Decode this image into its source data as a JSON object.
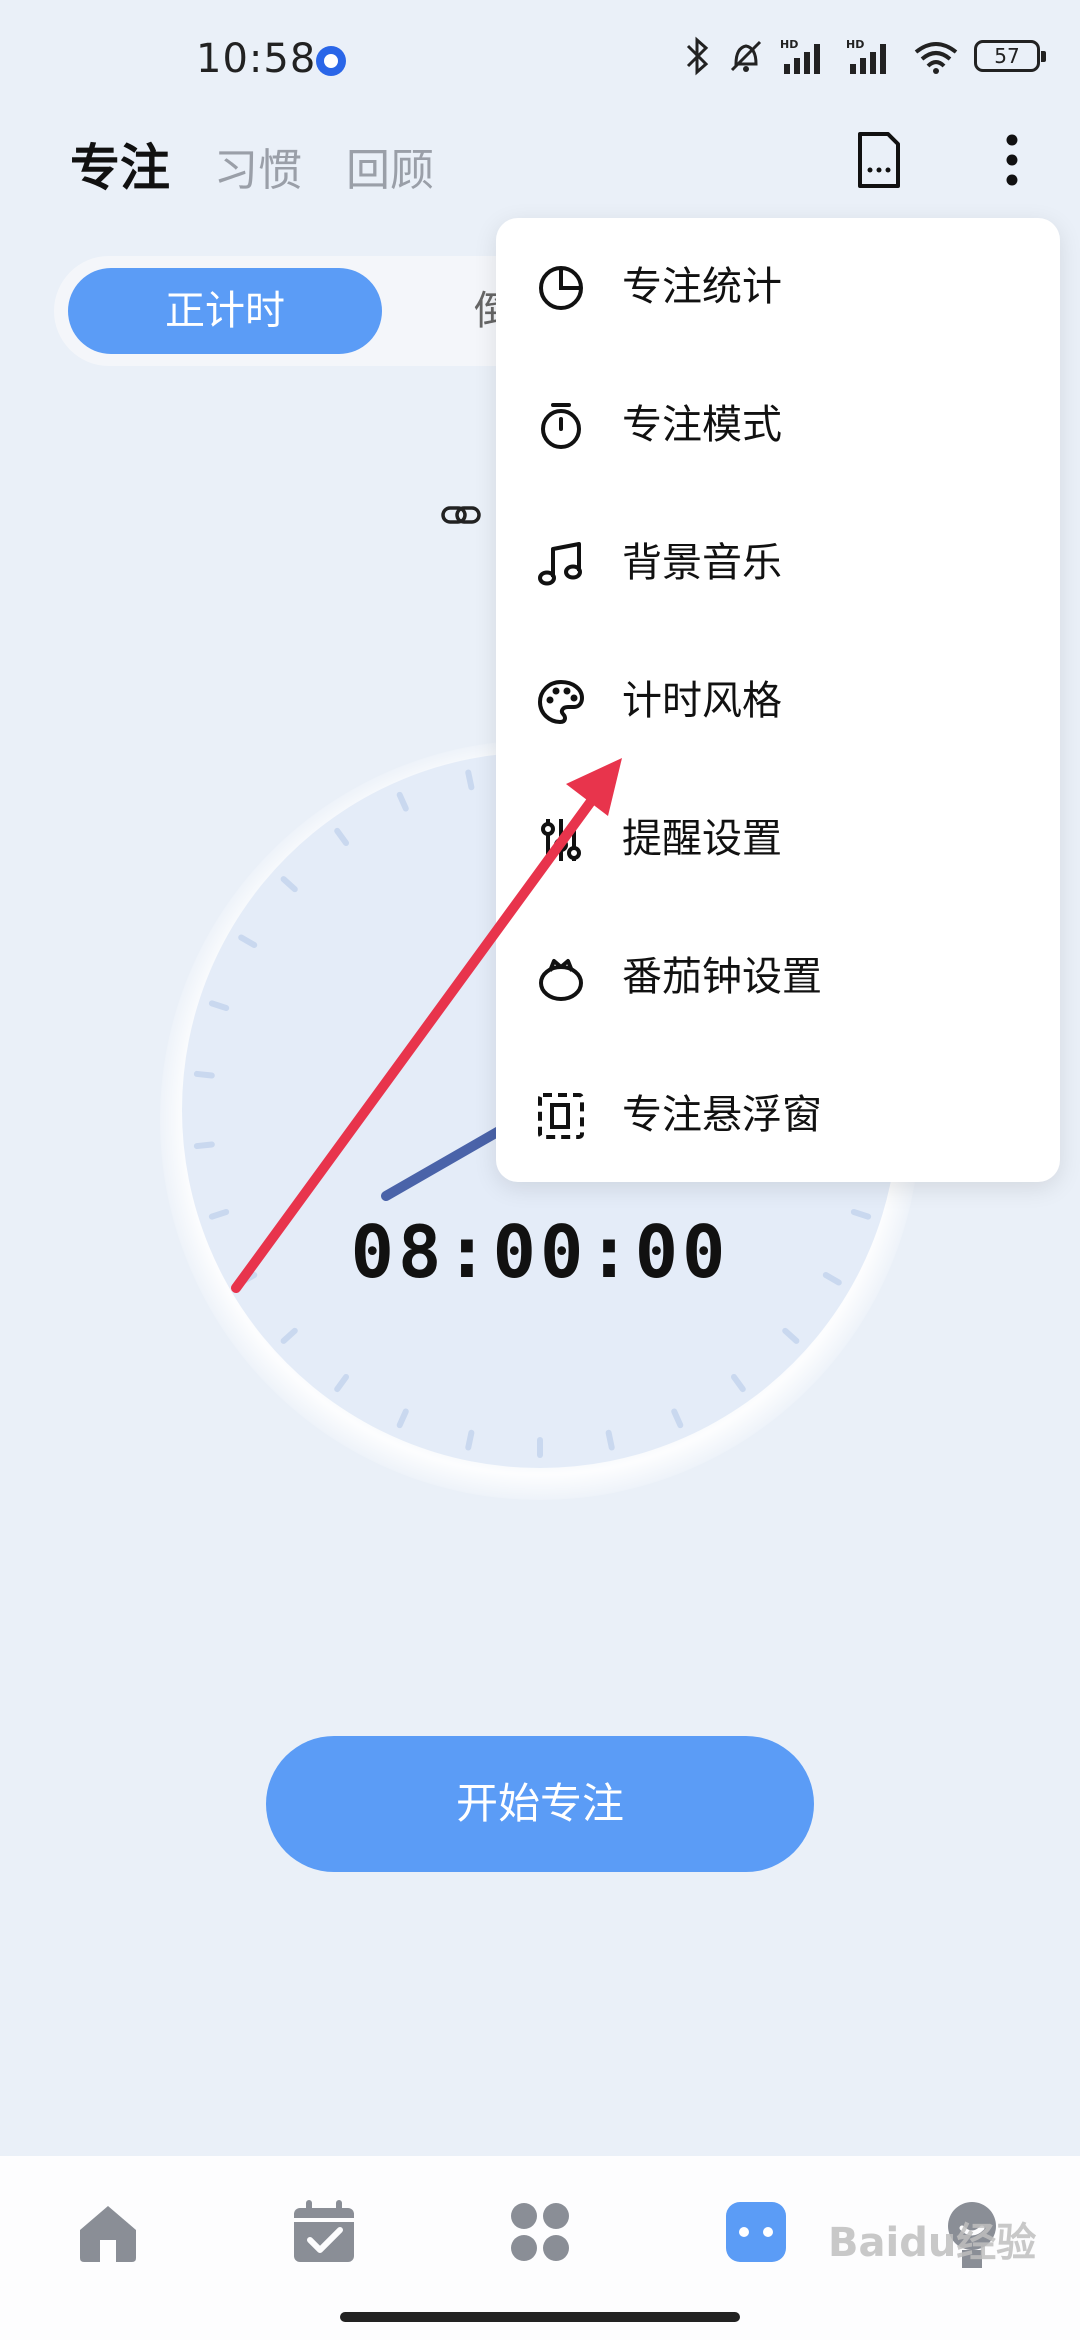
{
  "status_bar": {
    "time": "10:58",
    "battery": "57"
  },
  "header": {
    "tabs": [
      {
        "label": "专注"
      },
      {
        "label": "习惯"
      },
      {
        "label": "回顾"
      }
    ]
  },
  "segment": {
    "active_label": "正计时",
    "other_label": "倒"
  },
  "timer": {
    "display": "08:00:00"
  },
  "start_button": {
    "label": "开始专注"
  },
  "menu": {
    "items": [
      {
        "label": "专注统计",
        "icon": "pie-chart-icon"
      },
      {
        "label": "专注模式",
        "icon": "stopwatch-icon"
      },
      {
        "label": "背景音乐",
        "icon": "music-note-icon"
      },
      {
        "label": "计时风格",
        "icon": "palette-icon"
      },
      {
        "label": "提醒设置",
        "icon": "sliders-icon"
      },
      {
        "label": "番茄钟设置",
        "icon": "tomato-icon"
      },
      {
        "label": "专注悬浮窗",
        "icon": "floating-window-icon"
      }
    ]
  },
  "bottom_nav": {
    "items": [
      {
        "icon": "home-icon"
      },
      {
        "icon": "calendar-check-icon"
      },
      {
        "icon": "apps-grid-icon"
      },
      {
        "icon": "focus-icon"
      },
      {
        "icon": "profile-icon"
      }
    ]
  },
  "watermark": {
    "text": "Baidu经验"
  },
  "colors": {
    "accent": "#5b9cf6",
    "annotation_arrow": "#e8344c",
    "background": "#eaf0f8"
  }
}
